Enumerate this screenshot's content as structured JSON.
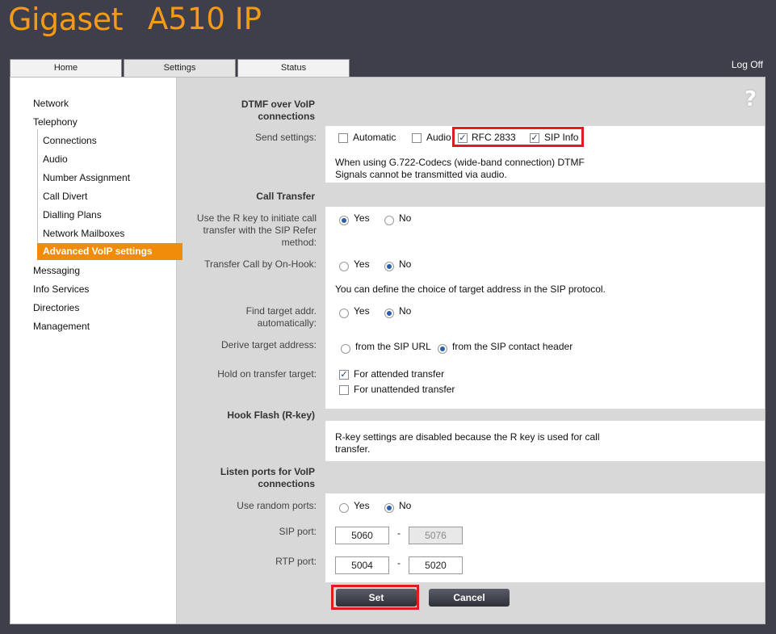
{
  "header": {
    "brand": "Gigaset",
    "model": "A510 IP",
    "logoff": "Log Off"
  },
  "tabs": [
    {
      "label": "Home"
    },
    {
      "label": "Settings"
    },
    {
      "label": "Status"
    }
  ],
  "sidebar": {
    "network": "Network",
    "telephony": "Telephony",
    "connections": "Connections",
    "audio": "Audio",
    "number_assignment": "Number Assignment",
    "call_divert": "Call Divert",
    "dialling_plans": "Dialling Plans",
    "network_mailboxes": "Network Mailboxes",
    "advanced_voip": "Advanced VoIP settings",
    "messaging": "Messaging",
    "info_services": "Info Services",
    "directories": "Directories",
    "management": "Management"
  },
  "help_icon": "?",
  "dtmf": {
    "title_line1": "DTMF over VoIP",
    "title_line2": "connections",
    "send_label": "Send settings:",
    "automatic": "Automatic",
    "audio": "Audio",
    "rfc": "RFC 2833",
    "sip_info": "SIP Info",
    "note_line1": "When using G.722-Codecs (wide-band connection) DTMF",
    "note_line2": "Signals cannot be transmitted via audio."
  },
  "call_transfer": {
    "title": "Call Transfer",
    "rkey_line1": "Use the R key to initiate call",
    "rkey_line2": "transfer with the SIP Refer",
    "rkey_line3": "method:",
    "onhook_label": "Transfer Call by On-Hook:",
    "target_note": "You can define the choice of target address in the SIP protocol.",
    "find_line1": "Find target addr.",
    "find_line2": "automatically:",
    "derive_label": "Derive target address:",
    "from_url": "from the SIP URL",
    "from_contact": "from the SIP contact header",
    "hold_label": "Hold on transfer target:",
    "attended": "For attended transfer",
    "unattended": "For unattended transfer",
    "yes": "Yes",
    "no": "No"
  },
  "hook_flash": {
    "title": "Hook Flash (R-key)",
    "note_line1": "R-key settings are disabled because the R key is used for call",
    "note_line2": "transfer."
  },
  "listen_ports": {
    "title_line1": "Listen ports for VoIP",
    "title_line2": "connections",
    "random_label": "Use random ports:",
    "sip_label": "SIP port:",
    "rtp_label": "RTP port:",
    "sip_from": "5060",
    "sip_to": "5076",
    "rtp_from": "5004",
    "rtp_to": "5020",
    "dash": "-"
  },
  "buttons": {
    "set": "Set",
    "cancel": "Cancel"
  },
  "colors": {
    "accent": "#f39a16",
    "highlight": "#e01b24",
    "background": "#3f3e4b"
  }
}
